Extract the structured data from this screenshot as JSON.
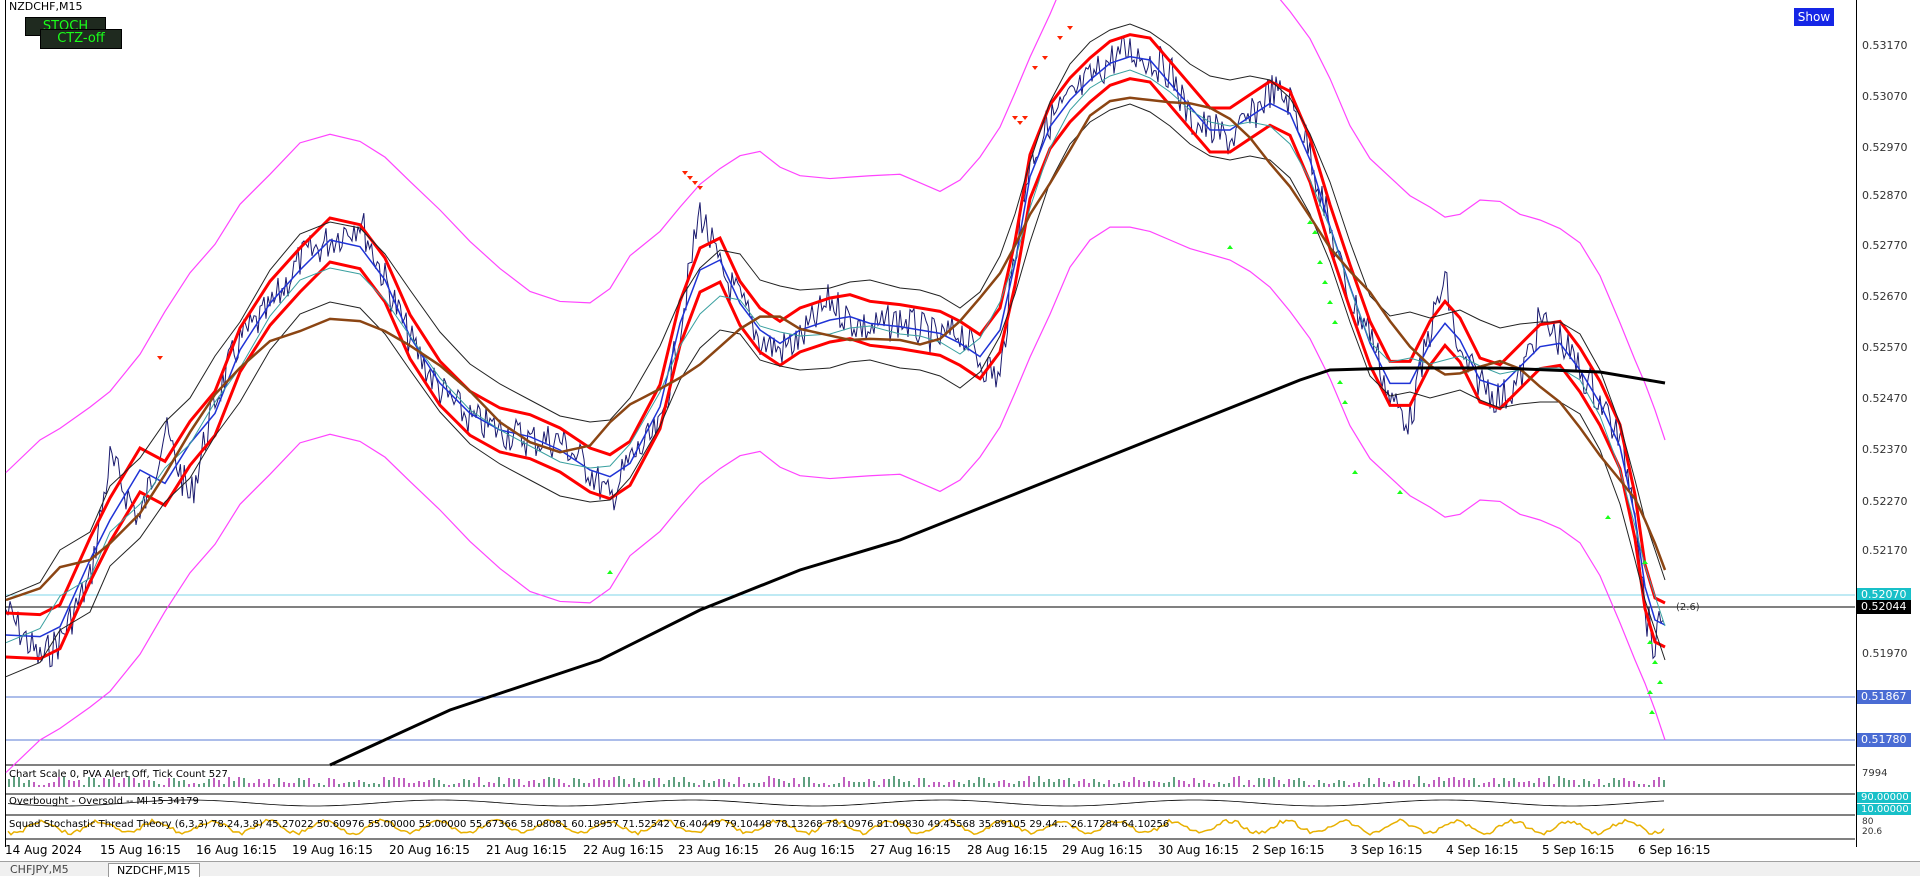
{
  "chart": {
    "title": "NZDCHF,M15",
    "show_button": "Show",
    "indicator_buttons": {
      "stoch": "STOCH",
      "ctz": "CTZ-off"
    },
    "level_labels": [
      "0.52070",
      "0.52044",
      "0.51867",
      "0.51780"
    ],
    "current_tag": "(2.6)"
  },
  "price_axis": [
    "0.53170",
    "0.53070",
    "0.52970",
    "0.52870",
    "0.52770",
    "0.52670",
    "0.52570",
    "0.52470",
    "0.52370",
    "0.52270",
    "0.52170",
    "0.51970"
  ],
  "subwindows": {
    "volume_label": "Chart Scale 0,  PVA Alert Off,  Tick Count  527",
    "volume_axis": "7994",
    "overbought_label": "Overbought - Oversold -- Ml 15 34179",
    "overbought_levels": [
      "90.00000",
      "10.00000"
    ],
    "stoch_label": "Squad Stochastic Thread Theory (6,3,3) 78.24,3.8) 45.27022 50.60976 55.00000 55.00000 55.67366 58.08081 60.18957 71.52542 76.40449 79.10448 78.13268 78.10976 81.09830 49.45568 35.89105 29.44... 26.17284 64.10256",
    "stoch_axis": [
      "80",
      "20.6"
    ]
  },
  "time_axis": [
    "14 Aug 2024",
    "15 Aug 16:15",
    "16 Aug 16:15",
    "19 Aug 16:15",
    "20 Aug 16:15",
    "21 Aug 16:15",
    "22 Aug 16:15",
    "23 Aug 16:15",
    "26 Aug 16:15",
    "27 Aug 16:15",
    "28 Aug 16:15",
    "29 Aug 16:15",
    "30 Aug 16:15",
    "2 Sep 16:15",
    "3 Sep 16:15",
    "4 Sep 16:15",
    "5 Sep 16:15",
    "6 Sep 16:15"
  ],
  "tabs": [
    "CHFJPY,M5",
    "NZDCHF,M15"
  ],
  "colors": {
    "price": "#1a1a6e",
    "band_outer": "#ff44ff",
    "band_red": "#ff0000",
    "ma_brown": "#8b4513",
    "ma_black": "#000000",
    "arrow_up": "#19ff19",
    "arrow_down": "#ff2200"
  }
}
